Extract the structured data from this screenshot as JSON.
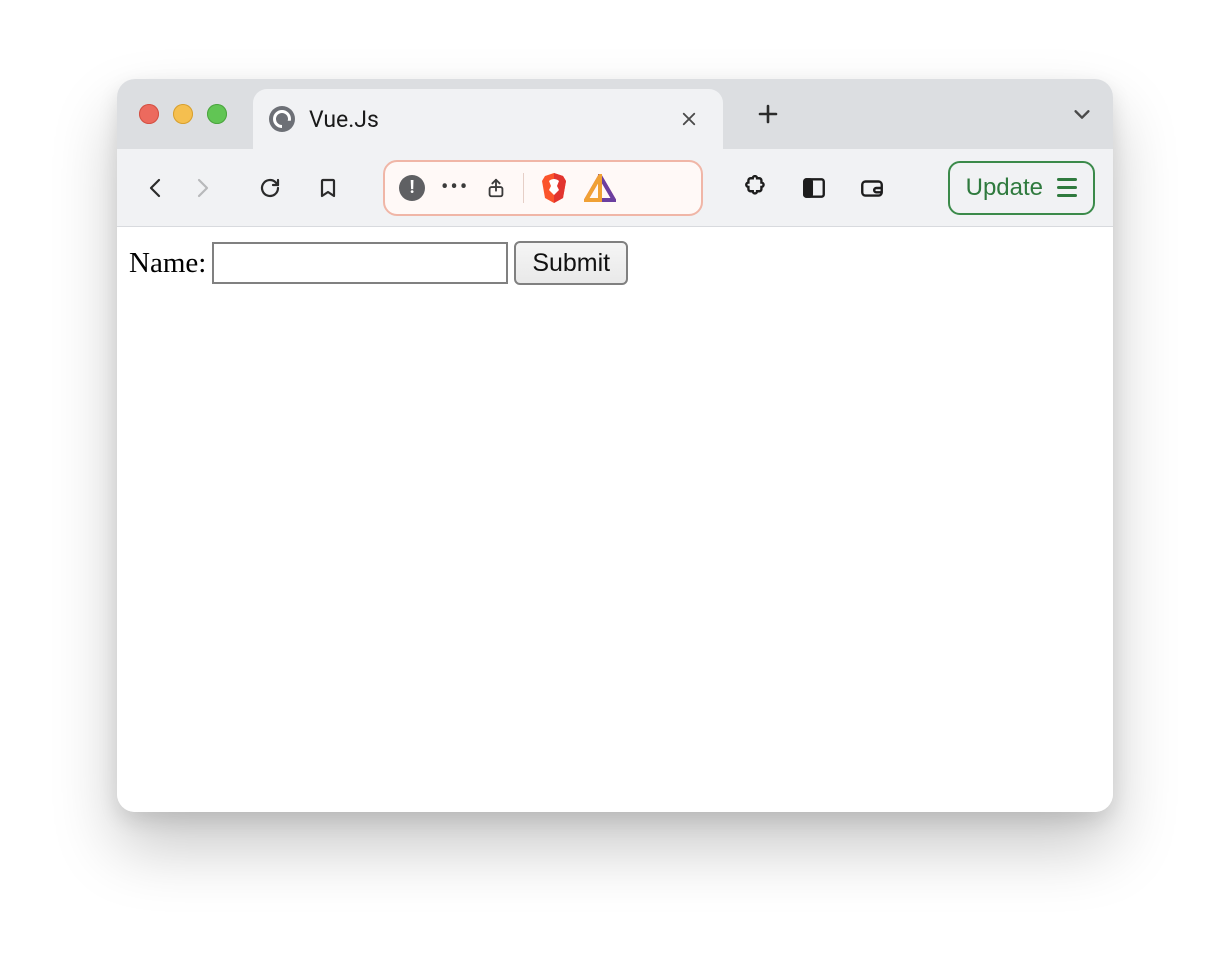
{
  "colors": {
    "tabstrip_bg": "#dcdee1",
    "toolbar_bg": "#f1f2f4",
    "omnibox_border": "#f0b6a7",
    "omnibox_bg": "#fff9f7",
    "update_border": "#3b8a4a",
    "update_text": "#2f7a3e"
  },
  "window": {
    "tab": {
      "title": "Vue.Js"
    },
    "toolbar": {
      "update_label": "Update"
    }
  },
  "page": {
    "form": {
      "name_label": "Name:",
      "name_value": "",
      "submit_label": "Submit"
    }
  }
}
